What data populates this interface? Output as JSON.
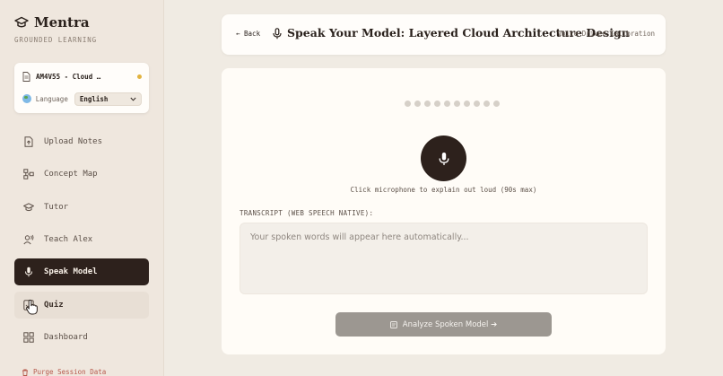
{
  "brand": {
    "name": "Mentra",
    "tagline": "GROUNDED LEARNING"
  },
  "document": {
    "name": "AM4V55 - Cloud …",
    "status_color": "#e2b33f"
  },
  "language": {
    "label": "Language",
    "selected": "English"
  },
  "nav": {
    "items": [
      {
        "label": "Upload Notes",
        "icon": "upload-file-icon"
      },
      {
        "label": "Concept Map",
        "icon": "concept-map-icon"
      },
      {
        "label": "Tutor",
        "icon": "graduation-cap-icon"
      },
      {
        "label": "Teach Alex",
        "icon": "teach-user-icon"
      },
      {
        "label": "Speak Model",
        "icon": "microphone-icon",
        "active": true
      },
      {
        "label": "Quiz",
        "icon": "quiz-icon"
      },
      {
        "label": "Dashboard",
        "icon": "dashboard-icon"
      }
    ],
    "purge_label": "Purge Session Data"
  },
  "header": {
    "back_label": "← Back",
    "title": "Speak Your Model: Layered Cloud Architecture Design",
    "tag": "Voice-Driven Calibration"
  },
  "main": {
    "hint": "Click microphone to explain out loud (90s max)",
    "transcript_label": "TRANSCRIPT (WEB SPEECH NATIVE):",
    "transcript_placeholder": "Your spoken words will appear here automatically...",
    "analyze_label": "Analyze Spoken Model ➔"
  },
  "colors": {
    "accent_dark": "#2d211c",
    "background": "#f0ebe3",
    "card": "#fffcf7",
    "danger": "#b65a4c"
  }
}
